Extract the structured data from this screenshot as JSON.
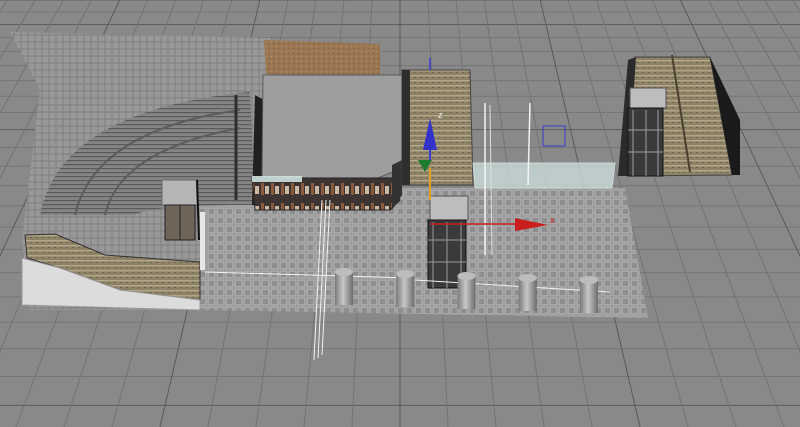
{
  "viewport": {
    "type": "3d-perspective-viewport",
    "background_color": "#898989",
    "grid_color": "#6f6f6f",
    "grid_major_color": "#4a4a4a"
  },
  "scene": {
    "objects": [
      "curved-stadium-stairs",
      "flat-plaza-floor",
      "left-ramp-stairs",
      "sand-patch",
      "rear-stair-block",
      "right-stair-block",
      "elevator-tower-left",
      "elevator-tower-center",
      "elevator-tower-right",
      "glass-shop-front",
      "glass-railing",
      "bollard-row"
    ],
    "bollard_count": 5
  },
  "gizmo": {
    "icon": "move-transform-gizmo",
    "x_axis_label": "x",
    "z_axis_label": "z",
    "x_axis_color": "#c81e1e",
    "y_axis_color": "#1e8a2e",
    "z_axis_color": "#3030c8",
    "pivot_color": "#e0a020"
  },
  "colors": {
    "stone_light": "#a3a3a3",
    "stone_dark": "#6b6b6b",
    "stairs_brown": "#8f8264",
    "sand": "#9c7a55",
    "wall_white": "#dcdcdc",
    "glass": "#cfe3e0"
  }
}
